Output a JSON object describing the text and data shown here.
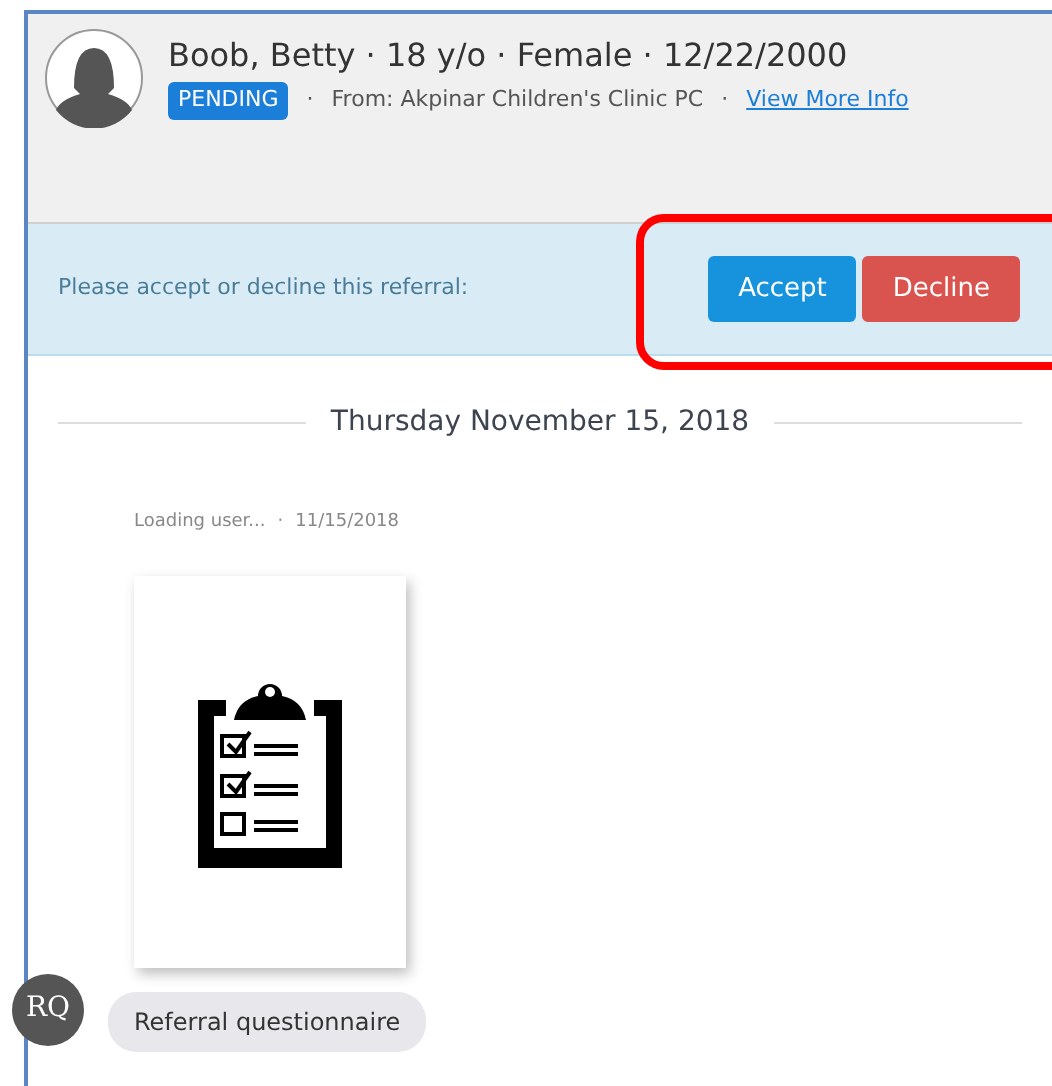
{
  "patient": {
    "title": "Boob, Betty · 18 y/o · Female · 12/22/2000",
    "status": "PENDING",
    "separator_1": "·",
    "from": "From: Akpinar Children's Clinic PC",
    "separator_2": "·",
    "link": "View More Info"
  },
  "referral_bar": {
    "prompt": "Please accept or decline this referral:",
    "buttons": [
      {
        "label": "Accept",
        "kind": "primary"
      },
      {
        "label": "Decline",
        "kind": "danger"
      }
    ]
  },
  "date_divider": "Thursday November 15, 2018",
  "message": {
    "author": "Loading user...",
    "separator": "·",
    "date": "11/15/2018",
    "avatar_initials": "RQ",
    "text": "Referral questionnaire"
  }
}
